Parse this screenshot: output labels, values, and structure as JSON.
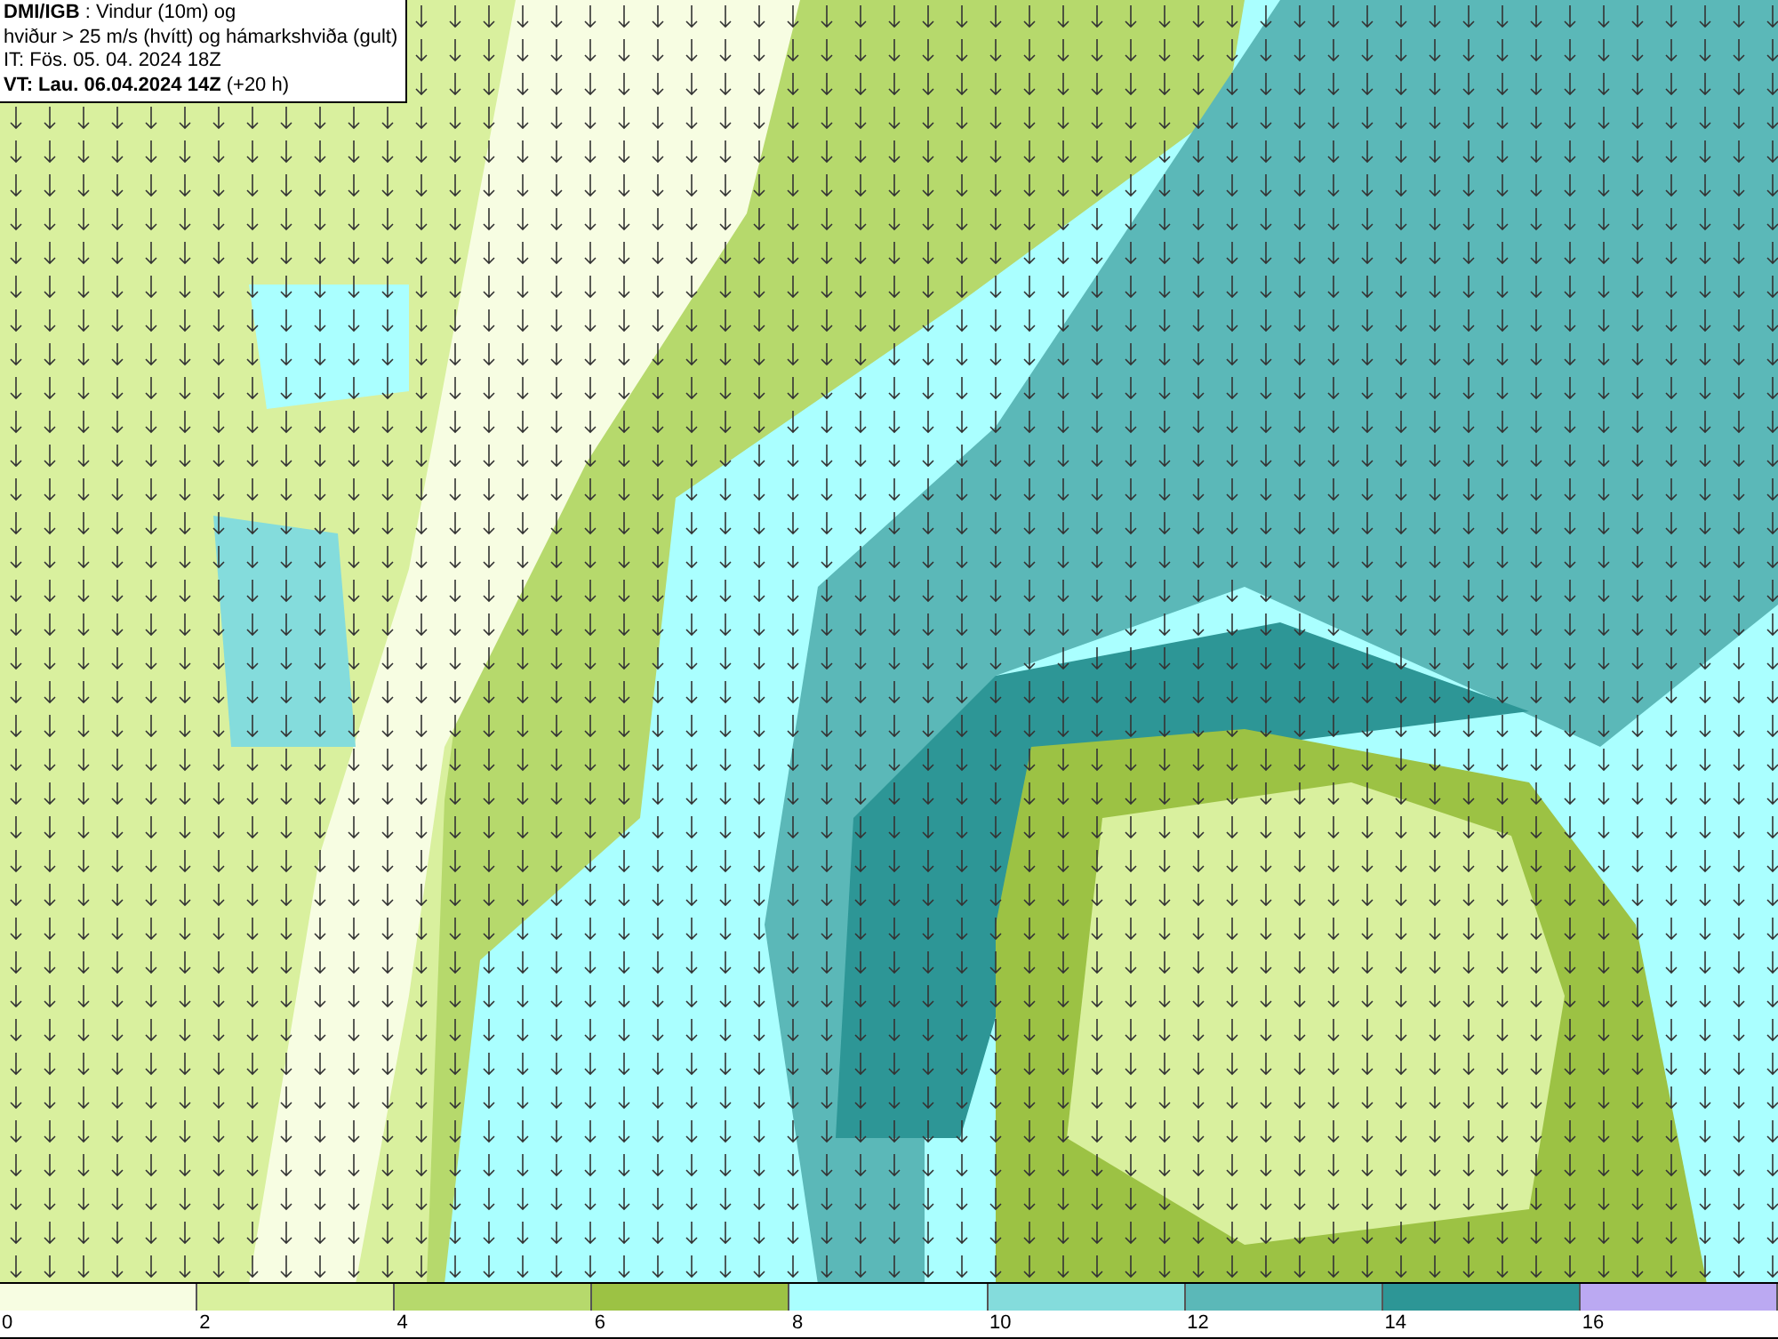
{
  "info_box": {
    "lines": [
      "**DMI/IGB** : Vindur (10m) og",
      "hviður > 25 m/s (hvítt) og hámarkshviða (gult)",
      "IT: Fös. 05. 04. 2024 18Z",
      "**VT: Lau. 06.04.2024 14Z** (+20 h)"
    ]
  },
  "legend": {
    "bins": [
      {
        "color": "#f7fde2",
        "tick": "0"
      },
      {
        "color": "#d9f09e",
        "tick": "2"
      },
      {
        "color": "#b6d96c",
        "tick": "4"
      },
      {
        "color": "#9cc244",
        "tick": "6"
      },
      {
        "color": "#aaffff",
        "tick": "8"
      },
      {
        "color": "#84dcdc",
        "tick": "10"
      },
      {
        "color": "#5bb8b8",
        "tick": "12"
      },
      {
        "color": "#2d9696",
        "tick": "14"
      },
      {
        "color": "#bba9f2",
        "tick": "16"
      }
    ]
  }
}
